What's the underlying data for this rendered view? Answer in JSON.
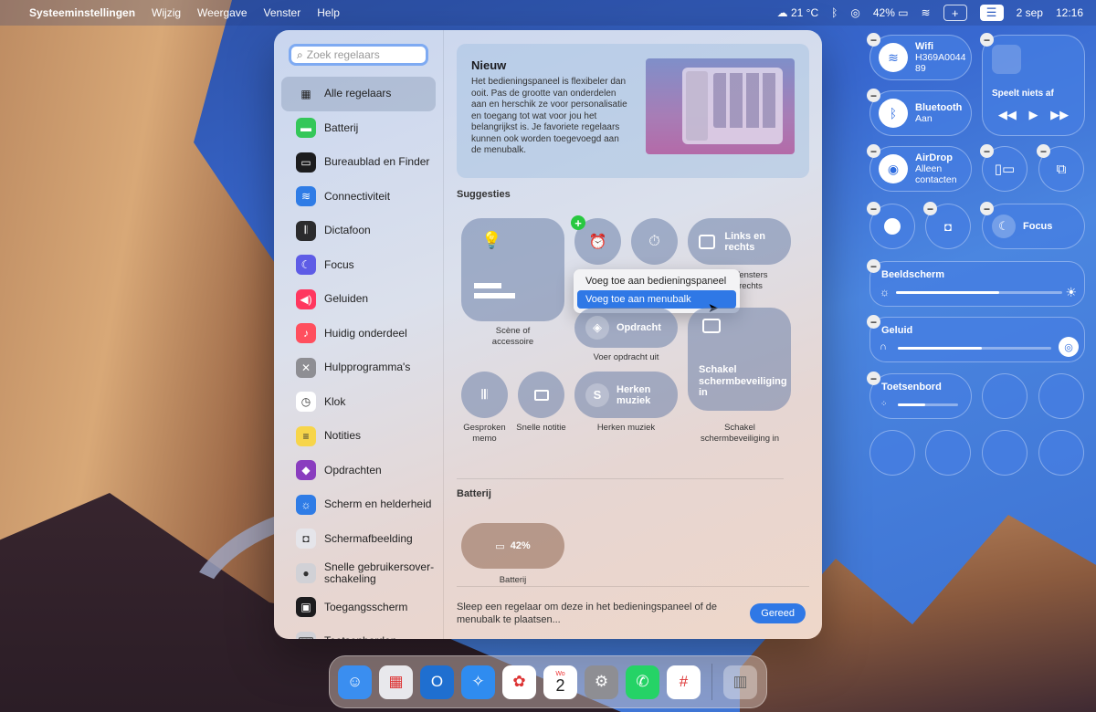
{
  "menubar": {
    "app_name": "Systeeminstellingen",
    "menus": [
      "Wijzig",
      "Weergave",
      "Venster",
      "Help"
    ],
    "weather": "21 °C",
    "battery": "42%",
    "date": "2 sep",
    "time": "12:16"
  },
  "search": {
    "placeholder": "Zoek regelaars"
  },
  "sidebar": {
    "items": [
      {
        "label": "Alle regelaars",
        "icon": "grid-icon",
        "color": "#00000000",
        "selected": true
      },
      {
        "label": "Batterij",
        "icon": "battery-icon",
        "color": "#34c759"
      },
      {
        "label": "Bureaublad en Finder",
        "icon": "desktop-icon",
        "color": "#1c1c1e"
      },
      {
        "label": "Connectiviteit",
        "icon": "wifi-icon",
        "color": "#2f7ce6"
      },
      {
        "label": "Dictafoon",
        "icon": "waveform-icon",
        "color": "#2b2b2d"
      },
      {
        "label": "Focus",
        "icon": "moon-icon",
        "color": "#5e5ce6"
      },
      {
        "label": "Geluiden",
        "icon": "speaker-icon",
        "color": "#ff375f"
      },
      {
        "label": "Huidig onderdeel",
        "icon": "audio-icon",
        "color": "#ff4f5e"
      },
      {
        "label": "Hulpprogramma's",
        "icon": "tools-icon",
        "color": "#8e8e93"
      },
      {
        "label": "Klok",
        "icon": "clock-icon",
        "color": "#ffffff"
      },
      {
        "label": "Notities",
        "icon": "notes-icon",
        "color": "#f7d54a"
      },
      {
        "label": "Opdrachten",
        "icon": "shortcuts-icon",
        "color": "#8a3dbf"
      },
      {
        "label": "Scherm en helderheid",
        "icon": "sun-icon",
        "color": "#2f7ce6"
      },
      {
        "label": "Schermafbeelding",
        "icon": "screenshot-icon",
        "color": "#e5e5ea"
      },
      {
        "label": "Snelle gebruikersover-schakeling",
        "icon": "user-icon",
        "color": "#d1d1d6"
      },
      {
        "label": "Toegangsscherm",
        "icon": "lock-icon",
        "color": "#1c1c1e"
      },
      {
        "label": "Toetsenborden",
        "icon": "keyboard-icon",
        "color": "#d1d1d6"
      }
    ]
  },
  "new_card": {
    "title": "Nieuw",
    "body": "Het bedieningspaneel is flexibeler dan ooit. Pas de grootte van onderdelen aan en herschik ze voor personalisatie en toegang tot wat voor jou het belangrijkst is. Je favoriete regelaars kunnen ook worden toegevoegd aan de menubalk."
  },
  "suggestions": {
    "title": "Suggesties",
    "scene_caption": "Scène of accessoire",
    "links_rechts": "Links en rechts",
    "links_rechts_caption": "Vensters rechts",
    "opdracht": "Opdracht",
    "opdracht_caption": "Voer opdracht uit",
    "screensaver": "Schakel schermbeveiliging in",
    "screensaver_caption": "Schakel schermbeveiliging in",
    "memo_caption": "Gesproken memo",
    "note_caption": "Snelle notitie",
    "herken": "Herken muziek",
    "herken_caption": "Herken muziek",
    "popup": {
      "item1": "Voeg toe aan bedieningspaneel",
      "item2": "Voeg toe aan menubalk"
    }
  },
  "battery_section": {
    "title": "Batterij",
    "value": "42%",
    "caption": "Batterij"
  },
  "footer": {
    "text": "Sleep een regelaar om deze in het bedieningspaneel of de menubalk te plaatsen...",
    "done": "Gereed"
  },
  "control_centre": {
    "wifi_title": "Wifi",
    "wifi_network": "H369A0044 89",
    "bluetooth_title": "Bluetooth",
    "bluetooth_status": "Aan",
    "airdrop_title": "AirDrop",
    "airdrop_status": "Alleen contacten",
    "now_playing": "Speelt niets af",
    "focus": "Focus",
    "display_title": "Beeldscherm",
    "display_level": 0.62,
    "sound_title": "Geluid",
    "sound_level": 0.55,
    "keyboard_title": "Toetsenbord",
    "keyboard_level": 0.45
  },
  "dock": {
    "apps": [
      {
        "name": "Finder",
        "icon": "finder-icon",
        "color": "#3a8ef0"
      },
      {
        "name": "Launchpad",
        "icon": "launchpad-icon",
        "color": "#e8e8ec"
      },
      {
        "name": "Outlook",
        "icon": "outlook-icon",
        "color": "#1f6fd0"
      },
      {
        "name": "Safari",
        "icon": "safari-icon",
        "color": "#2f8cf0"
      },
      {
        "name": "Foto's",
        "icon": "photos-icon",
        "color": "#ffffff"
      },
      {
        "name": "Agenda",
        "icon": "calendar-icon",
        "color": "#ffffff"
      },
      {
        "name": "Systeeminstellingen",
        "icon": "settings-icon",
        "color": "#8e8e93"
      },
      {
        "name": "WhatsApp",
        "icon": "whatsapp-icon",
        "color": "#25d366"
      },
      {
        "name": "Slack",
        "icon": "slack-icon",
        "color": "#ffffff"
      }
    ],
    "calendar_month": "Wo",
    "calendar_day": "2",
    "trash": {
      "name": "Prullenmand",
      "icon": "trash-icon"
    }
  }
}
